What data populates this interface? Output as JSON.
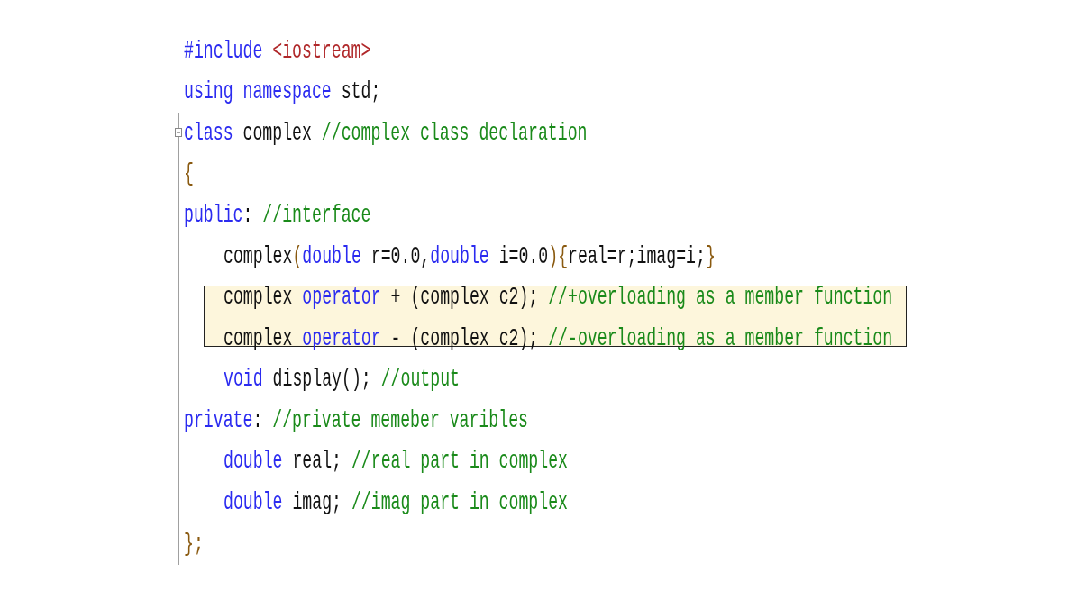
{
  "editor": {
    "lines": [
      {
        "indented": false,
        "highlighted": false,
        "tokens": [
          {
            "kind": "keyword",
            "text": "#include"
          },
          {
            "kind": "string",
            "text": " <iostream>"
          }
        ]
      },
      {
        "indented": false,
        "highlighted": false,
        "tokens": [
          {
            "kind": "keyword",
            "text": "using namespace"
          },
          {
            "kind": "plain",
            "text": " std;"
          }
        ]
      }
    ],
    "fold": {
      "collapsed": false,
      "lines": [
        {
          "indented": false,
          "highlighted": false,
          "tokens": [
            {
              "kind": "keyword",
              "text": "class"
            },
            {
              "kind": "plain",
              "text": " complex "
            },
            {
              "kind": "comment",
              "text": "//complex class declaration"
            }
          ]
        },
        {
          "indented": false,
          "highlighted": false,
          "tokens": [
            {
              "kind": "brace",
              "text": "{"
            }
          ]
        },
        {
          "indented": false,
          "highlighted": false,
          "tokens": [
            {
              "kind": "keyword",
              "text": "public"
            },
            {
              "kind": "plain",
              "text": ": "
            },
            {
              "kind": "comment",
              "text": "//interface"
            }
          ]
        },
        {
          "indented": true,
          "highlighted": false,
          "tokens": [
            {
              "kind": "plain",
              "text": "complex"
            },
            {
              "kind": "brace",
              "text": "("
            },
            {
              "kind": "keyword",
              "text": "double"
            },
            {
              "kind": "plain",
              "text": " r=0.0,"
            },
            {
              "kind": "keyword",
              "text": "double"
            },
            {
              "kind": "plain",
              "text": " i=0.0"
            },
            {
              "kind": "brace",
              "text": ")"
            },
            {
              "kind": "brace",
              "text": "{"
            },
            {
              "kind": "plain",
              "text": "real=r;imag=i;"
            },
            {
              "kind": "brace",
              "text": "}"
            }
          ]
        },
        {
          "indented": true,
          "highlighted": true,
          "tokens": [
            {
              "kind": "plain",
              "text": "complex "
            },
            {
              "kind": "keyword",
              "text": "operator"
            },
            {
              "kind": "plain",
              "text": " + (complex c2); "
            },
            {
              "kind": "comment",
              "text": "//+overloading as a member function"
            }
          ]
        },
        {
          "indented": true,
          "highlighted": true,
          "tokens": [
            {
              "kind": "plain",
              "text": "complex "
            },
            {
              "kind": "keyword",
              "text": "operator"
            },
            {
              "kind": "plain",
              "text": " - (complex c2); "
            },
            {
              "kind": "comment",
              "text": "//-overloading as a member function"
            }
          ]
        },
        {
          "indented": true,
          "highlighted": false,
          "tokens": [
            {
              "kind": "keyword",
              "text": "void"
            },
            {
              "kind": "plain",
              "text": " display(); "
            },
            {
              "kind": "comment",
              "text": "//output"
            }
          ]
        },
        {
          "indented": false,
          "highlighted": false,
          "tokens": [
            {
              "kind": "keyword",
              "text": "private"
            },
            {
              "kind": "plain",
              "text": ": "
            },
            {
              "kind": "comment",
              "text": "//private memeber varibles"
            }
          ]
        },
        {
          "indented": true,
          "highlighted": false,
          "tokens": [
            {
              "kind": "keyword",
              "text": "double"
            },
            {
              "kind": "plain",
              "text": " real; "
            },
            {
              "kind": "comment",
              "text": "//real part in complex"
            }
          ]
        },
        {
          "indented": true,
          "highlighted": false,
          "tokens": [
            {
              "kind": "keyword",
              "text": "double"
            },
            {
              "kind": "plain",
              "text": " imag; "
            },
            {
              "kind": "comment",
              "text": "//imag part in complex"
            }
          ]
        },
        {
          "indented": false,
          "highlighted": false,
          "tokens": [
            {
              "kind": "brace",
              "text": "};"
            }
          ]
        }
      ]
    }
  }
}
